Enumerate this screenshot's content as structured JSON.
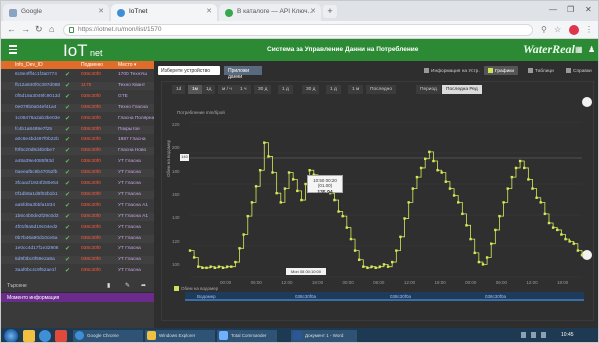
{
  "browser": {
    "tabs": [
      {
        "label": "Google"
      },
      {
        "label": "IoTnet"
      },
      {
        "label": "В каталоге — API Ключ..."
      }
    ],
    "url": "https://iotnet.ru/mon/list/1570",
    "window_controls": [
      "—",
      "❐",
      "✕"
    ]
  },
  "app": {
    "logo": "IoT",
    "logo_sub": "net",
    "title": "Система за Управление Данни на Потребление",
    "brand": "WaterReal"
  },
  "left_panel": {
    "headers": [
      "Info_Dev_ID",
      "Подменю",
      "Место ▾"
    ],
    "rows": [
      {
        "id": "6c8e4fff4c1f3a0774",
        "v": "038c30f0",
        "place": "1700 ТехнУш"
      },
      {
        "id": "fb12a840f0c397d088",
        "v": "1175",
        "place": "Техно Квант"
      },
      {
        "id": "0f5d18a3049fc9013d",
        "v": "038c30f0",
        "place": "GTE"
      },
      {
        "id": "0e079b0a04ef41a4",
        "v": "038c30f0",
        "place": "Техно Гласна"
      },
      {
        "id": "1c08476a2ab3be03e",
        "v": "038c30f0",
        "place": "Гласна Полярна"
      },
      {
        "id": "fc4b1a8489e7f25",
        "v": "038c30f0",
        "place": "Покрытое"
      },
      {
        "id": "a0c6e4bd497f0b22b",
        "v": "038c30f0",
        "place": "1887 Гласна"
      },
      {
        "id": "f0f5c20d8d4b0be7",
        "v": "038c30f0",
        "place": "Гласна Ново"
      },
      {
        "id": "a48a39e4085f93d",
        "v": "038c30f0",
        "place": "УТ Гласна"
      },
      {
        "id": "0aeeaf5c8b47052fb",
        "v": "038c30f0",
        "place": "УТ Гласна"
      },
      {
        "id": "3fcaacf1934f280e54",
        "v": "038c30f0",
        "place": "УТ Гласна"
      },
      {
        "id": "0f1db8a1d6f02b1b1",
        "v": "038c30f0",
        "place": "УТ Гласна"
      },
      {
        "id": "aa5fd9a3bbfa1834",
        "v": "038c30f0",
        "place": "УТ Гласна А1"
      },
      {
        "id": "1b6c4b0de2f29c0d3",
        "v": "038c30f0",
        "place": "УТ Гласна А1"
      },
      {
        "id": "4f01f8a5d19c04ed2",
        "v": "038c30f0",
        "place": "УТ Гласна"
      },
      {
        "id": "0b7b46a90d10ce5a",
        "v": "038c30f0",
        "place": "УТ Гласна"
      },
      {
        "id": "1e0cc4d17f1e32906",
        "v": "038c30f0",
        "place": "УТ Гласна"
      },
      {
        "id": "5d9f3bc0f59e2a8a",
        "v": "038c30f0",
        "place": "УТ Гласна"
      },
      {
        "id": "3aaf0bc4c9f52ae1f",
        "v": "038c30f0",
        "place": "УТ Гласна"
      }
    ],
    "footer_label": "Търсене",
    "purple_bar": "Моменто информация"
  },
  "main": {
    "select_placeholder": "Изберете устройство",
    "select_button": "Приложи данни",
    "top_tabs": [
      {
        "label": "Информация на Устр."
      },
      {
        "label": "Графики"
      },
      {
        "label": "Таблици"
      },
      {
        "label": "Справки"
      }
    ],
    "range_buttons": [
      "1d",
      "1м",
      "1д",
      "м / ч",
      "1 ч",
      "30 д",
      "1 д",
      "30 д",
      "1 д",
      "1 м",
      "Последно",
      "Период",
      "Последна Ред"
    ],
    "chart_title": "Потребление mm/брой",
    "y_axis_name": "Обем на водомер",
    "y_ticks": [
      "220",
      "200",
      "180",
      "160",
      "140",
      "120",
      "100"
    ],
    "x_ticks": [
      "00:00",
      "06:00",
      "12:00",
      "18:00",
      "00:00",
      "06:00",
      "12:00",
      "18:00",
      "00:00",
      "06:00",
      "12:00",
      "18:00"
    ],
    "tooltip_label": "10:50 00:20 (01.00)",
    "tooltip_value": "135.94",
    "ybox": "140",
    "xbox": "Mon 08 00:10:00",
    "legend": "Обем на водомер",
    "table_header": [
      "Водомер",
      "038c30f0a",
      "038c30f0a",
      "038c30f0a"
    ]
  },
  "chart_data": {
    "type": "line",
    "title": "Потребление mm/брой",
    "ylabel": "Обем на водомер",
    "xlabel": "",
    "ylim": [
      95,
      230
    ],
    "series": [
      {
        "name": "Обем на водомер",
        "color": "#d7e85a",
        "values": [
          118,
          112,
          104,
          103,
          103,
          104,
          103,
          104,
          103,
          104,
          104,
          108,
          120,
          132,
          148,
          160,
          174,
          188,
          212,
          200,
          186,
          168,
          160,
          172,
          186,
          180,
          170,
          162,
          176,
          188,
          184,
          178,
          170,
          176,
          168,
          162,
          152,
          148,
          138,
          128,
          118,
          110,
          104,
          103,
          104,
          103,
          104,
          106,
          104,
          108,
          118,
          130,
          146,
          160,
          172,
          182,
          190,
          198,
          204,
          196,
          188,
          186,
          178,
          172,
          166,
          160,
          150,
          140,
          128,
          116,
          108,
          106,
          112,
          124,
          136,
          148,
          160,
          172,
          182,
          190,
          196,
          190,
          180,
          172,
          164,
          160,
          150,
          142,
          138,
          136,
          132,
          128,
          126,
          124,
          118,
          114
        ]
      }
    ],
    "grid": true,
    "legend_position": "bottom-left"
  },
  "taskbar": {
    "clock": "10:45",
    "items": [
      "Google Chrome",
      "Windows Explorer",
      "Total Commander",
      "Документ 1 - Word"
    ]
  },
  "colors": {
    "header_green": "#2c8a34",
    "left_header_orange": "#e16c2a",
    "line": "#d7e85a",
    "purple": "#6a2b8c"
  }
}
